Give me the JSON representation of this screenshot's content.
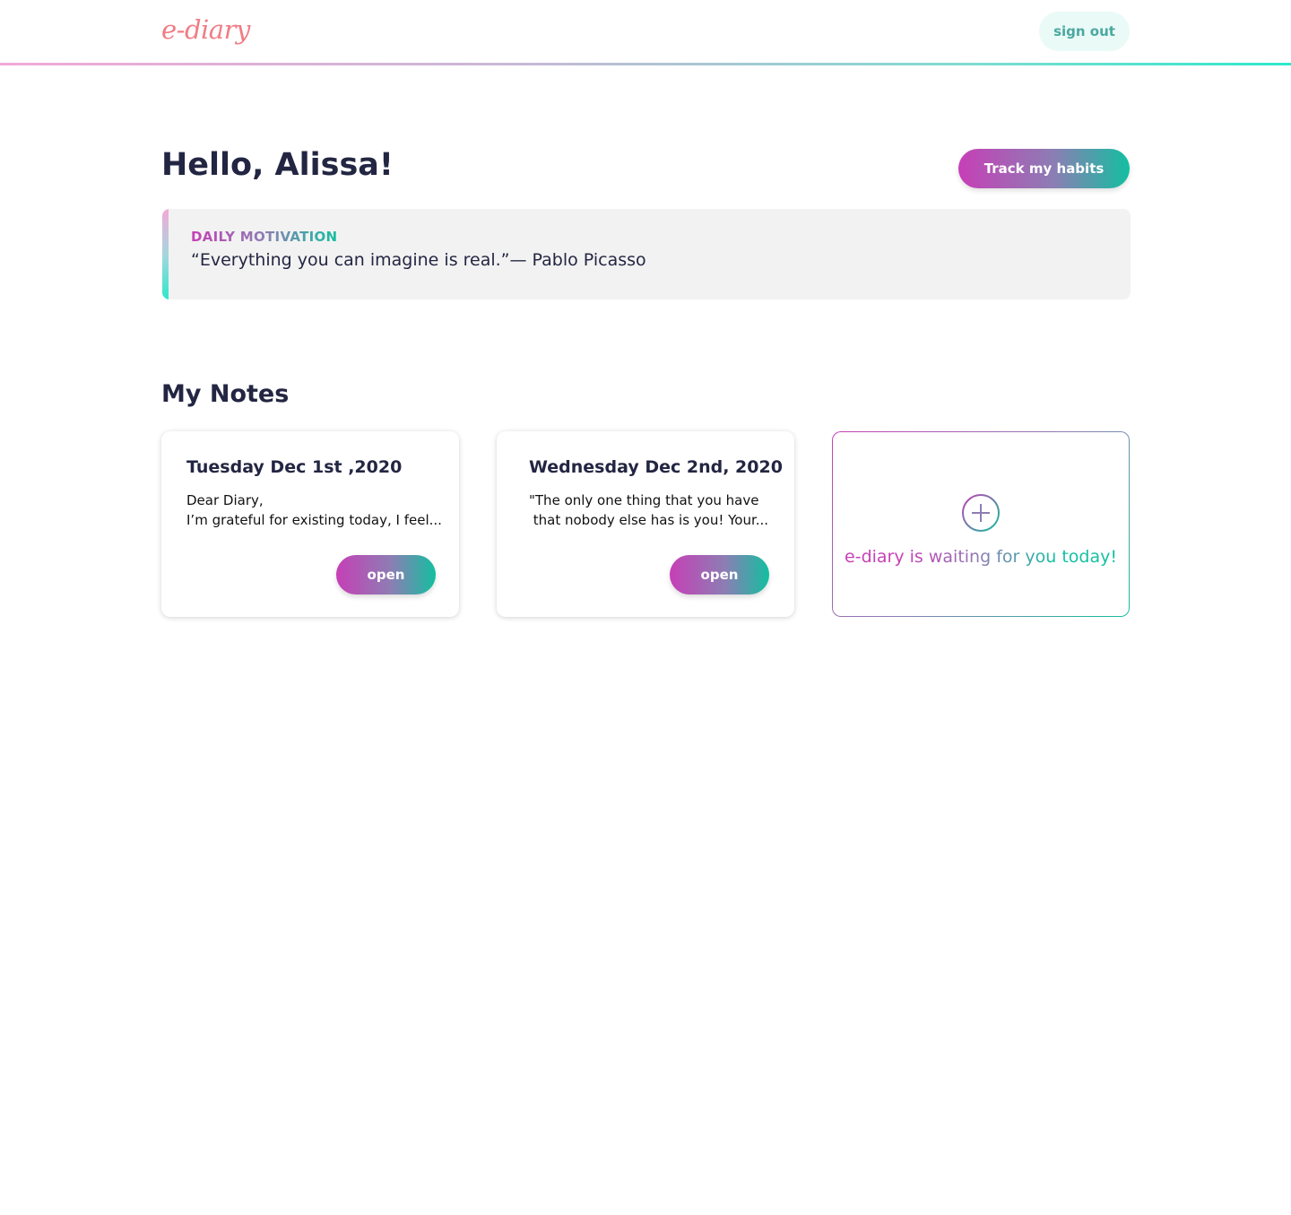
{
  "header": {
    "logo": "e-diary",
    "signout_label": "sign out"
  },
  "main": {
    "greeting": "Hello, Alissa!",
    "habits_label": "Track my habits",
    "motivation": {
      "label": "DAILY MOTIVATION",
      "quote": "“Everything you can imagine is real.”— Pablo Picasso"
    },
    "notes_title": "My Notes",
    "notes": [
      {
        "date": "Tuesday Dec 1st ,2020",
        "excerpt": "Dear Diary,\nI’m grateful for existing today, I feel...",
        "open_label": "open"
      },
      {
        "date": "Wednesday Dec 2nd, 2020",
        "excerpt": "\"The only one thing that you have\n that nobody else has is you! Your...",
        "open_label": "open"
      }
    ],
    "new_note": {
      "icon": "plus-circle-icon",
      "text": "e-diary is waiting for you today!"
    }
  },
  "colors": {
    "logo": "#f07c84",
    "text_dark": "#232642",
    "gradient_start": "#c63fb6",
    "gradient_mid": "#8d7db4",
    "gradient_end": "#12bfa0",
    "signout_bg": "#eafaf7",
    "motivation_bg": "#f2f2f2"
  }
}
